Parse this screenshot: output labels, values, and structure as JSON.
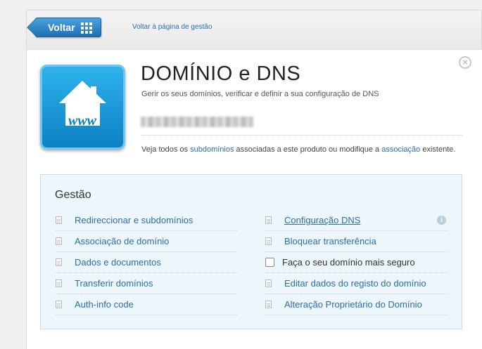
{
  "nav": {
    "back_label": "Voltar",
    "back_link": "Voltar à página de gestão"
  },
  "header": {
    "title": "DOMÍNIO e DNS",
    "subtitle": "Gerir os seus domínios, verificar e definir a sua configuração de DNS",
    "icon_text": "www",
    "description": {
      "part1": "Veja todos os ",
      "link1": "subdomínios",
      "part2": " associadas a este produto ou modifique a ",
      "link2": "associação",
      "part3": " existente."
    }
  },
  "management": {
    "heading": "Gestão",
    "left": [
      "Redireccionar e subdomínios",
      "Associação de domínio",
      "Dados e documentos",
      "Transferir domínios",
      "Auth-info code"
    ],
    "right": [
      "Configuração DNS",
      "Bloquear transferência",
      "Faça o seu domínio mais seguro",
      "Editar dados do registo do domínio",
      "Alteração Proprietário do Domínio"
    ]
  },
  "icons": {
    "close": "close-icon",
    "info": "info-icon",
    "grid": "grid-icon",
    "app": "house-www-icon"
  }
}
